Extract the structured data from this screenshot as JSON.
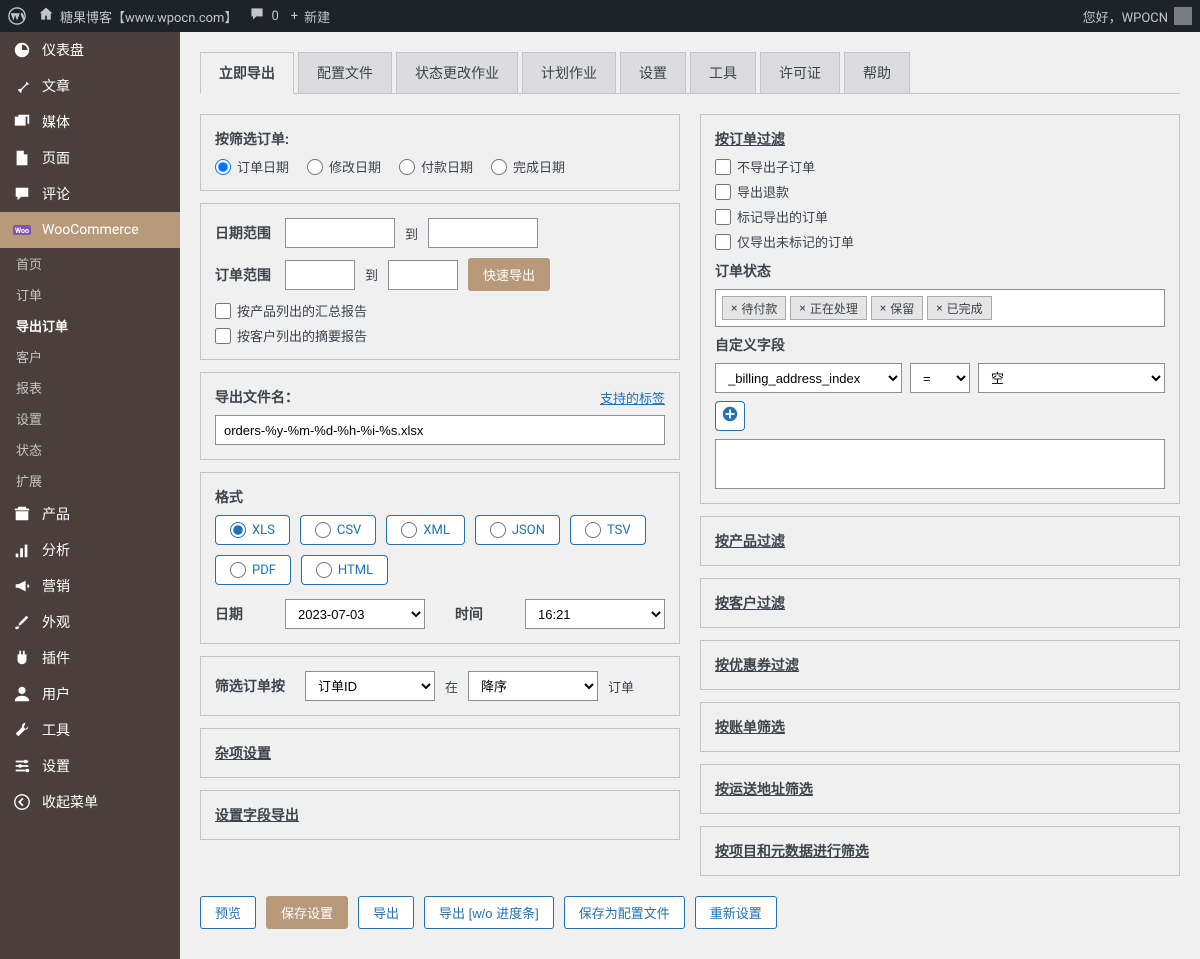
{
  "adminbar": {
    "site_title": "糖果博客【www.wpocn.com】",
    "comments": "0",
    "new_label": "新建",
    "greeting": "您好，WPOCN"
  },
  "sidebar": {
    "dashboard": "仪表盘",
    "posts": "文章",
    "media": "媒体",
    "pages": "页面",
    "comments": "评论",
    "woocommerce": "WooCommerce",
    "wc_subs": [
      "首页",
      "订单",
      "导出订单",
      "客户",
      "报表",
      "设置",
      "状态",
      "扩展"
    ],
    "products": "产品",
    "analytics": "分析",
    "marketing": "营销",
    "appearance": "外观",
    "plugins": "插件",
    "users": "用户",
    "tools": "工具",
    "settings": "设置",
    "collapse": "收起菜单"
  },
  "tabs": [
    "立即导出",
    "配置文件",
    "状态更改作业",
    "计划作业",
    "设置",
    "工具",
    "许可证",
    "帮助"
  ],
  "filter_orders": {
    "title": "按筛选订单:",
    "options": [
      "订单日期",
      "修改日期",
      "付款日期",
      "完成日期"
    ]
  },
  "date_range": {
    "label": "日期范围",
    "to": "到"
  },
  "order_range": {
    "label": "订单范围",
    "to": "到",
    "quick": "快速导出"
  },
  "summary": {
    "by_product": "按产品列出的汇总报告",
    "by_customer": "按客户列出的摘要报告"
  },
  "filename": {
    "label": "导出文件名：",
    "tags_link": "支持的标签",
    "value": "orders-%y-%m-%d-%h-%i-%s.xlsx"
  },
  "format": {
    "label": "格式",
    "options": [
      "XLS",
      "CSV",
      "XML",
      "JSON",
      "TSV",
      "PDF",
      "HTML"
    ]
  },
  "datetime": {
    "date_label": "日期",
    "date_value": "2023-07-03",
    "time_label": "时间",
    "time_value": "16:21"
  },
  "sort": {
    "label": "筛选订单按",
    "field": "订单ID",
    "at": "在",
    "dir": "降序",
    "unit": "订单"
  },
  "misc": "杂项设置",
  "fields_export": "设置字段导出",
  "right": {
    "filter_title": "按订单过滤",
    "checks": [
      "不导出子订单",
      "导出退款",
      "标记导出的订单",
      "仅导出未标记的订单"
    ],
    "status_label": "订单状态",
    "statuses": [
      "待付款",
      "正在处理",
      "保留",
      "已完成"
    ],
    "custom_field": "自定义字段",
    "cf_field": "_billing_address_index",
    "cf_op": "=",
    "cf_val": "空",
    "sections": [
      "按产品过滤",
      "按客户过滤",
      "按优惠券过滤",
      "按账单筛选",
      "按运送地址筛选",
      "按项目和元数据进行筛选"
    ]
  },
  "actions": [
    "预览",
    "保存设置",
    "导出",
    "导出 [w/o 进度条]",
    "保存为配置文件",
    "重新设置"
  ]
}
